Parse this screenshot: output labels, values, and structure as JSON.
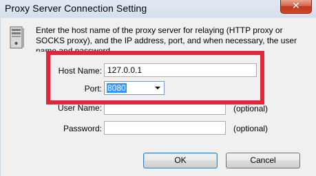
{
  "window": {
    "title": "Proxy Server Connection Setting",
    "close_glyph": "✕"
  },
  "description": "Enter the host name of the proxy server for relaying (HTTP proxy or SOCKS proxy), and the IP address, port, and when necessary, the user name and password.",
  "fields": {
    "host_name": {
      "label": "Host Name:",
      "value": "127.0.0.1"
    },
    "port": {
      "label": "Port:",
      "value": "8080"
    },
    "user_name": {
      "label": "User Name:",
      "value": "",
      "hint": "(optional)"
    },
    "password": {
      "label": "Password:",
      "value": "",
      "hint": "(optional)"
    }
  },
  "buttons": {
    "ok": "OK",
    "cancel": "Cancel"
  },
  "icons": {
    "server": "server-computer-icon",
    "close": "close-icon",
    "dropdown": "chevron-down-icon"
  },
  "colors": {
    "highlight": "#e0263b",
    "selection": "#3399ff",
    "close_button": "#c2371c"
  }
}
